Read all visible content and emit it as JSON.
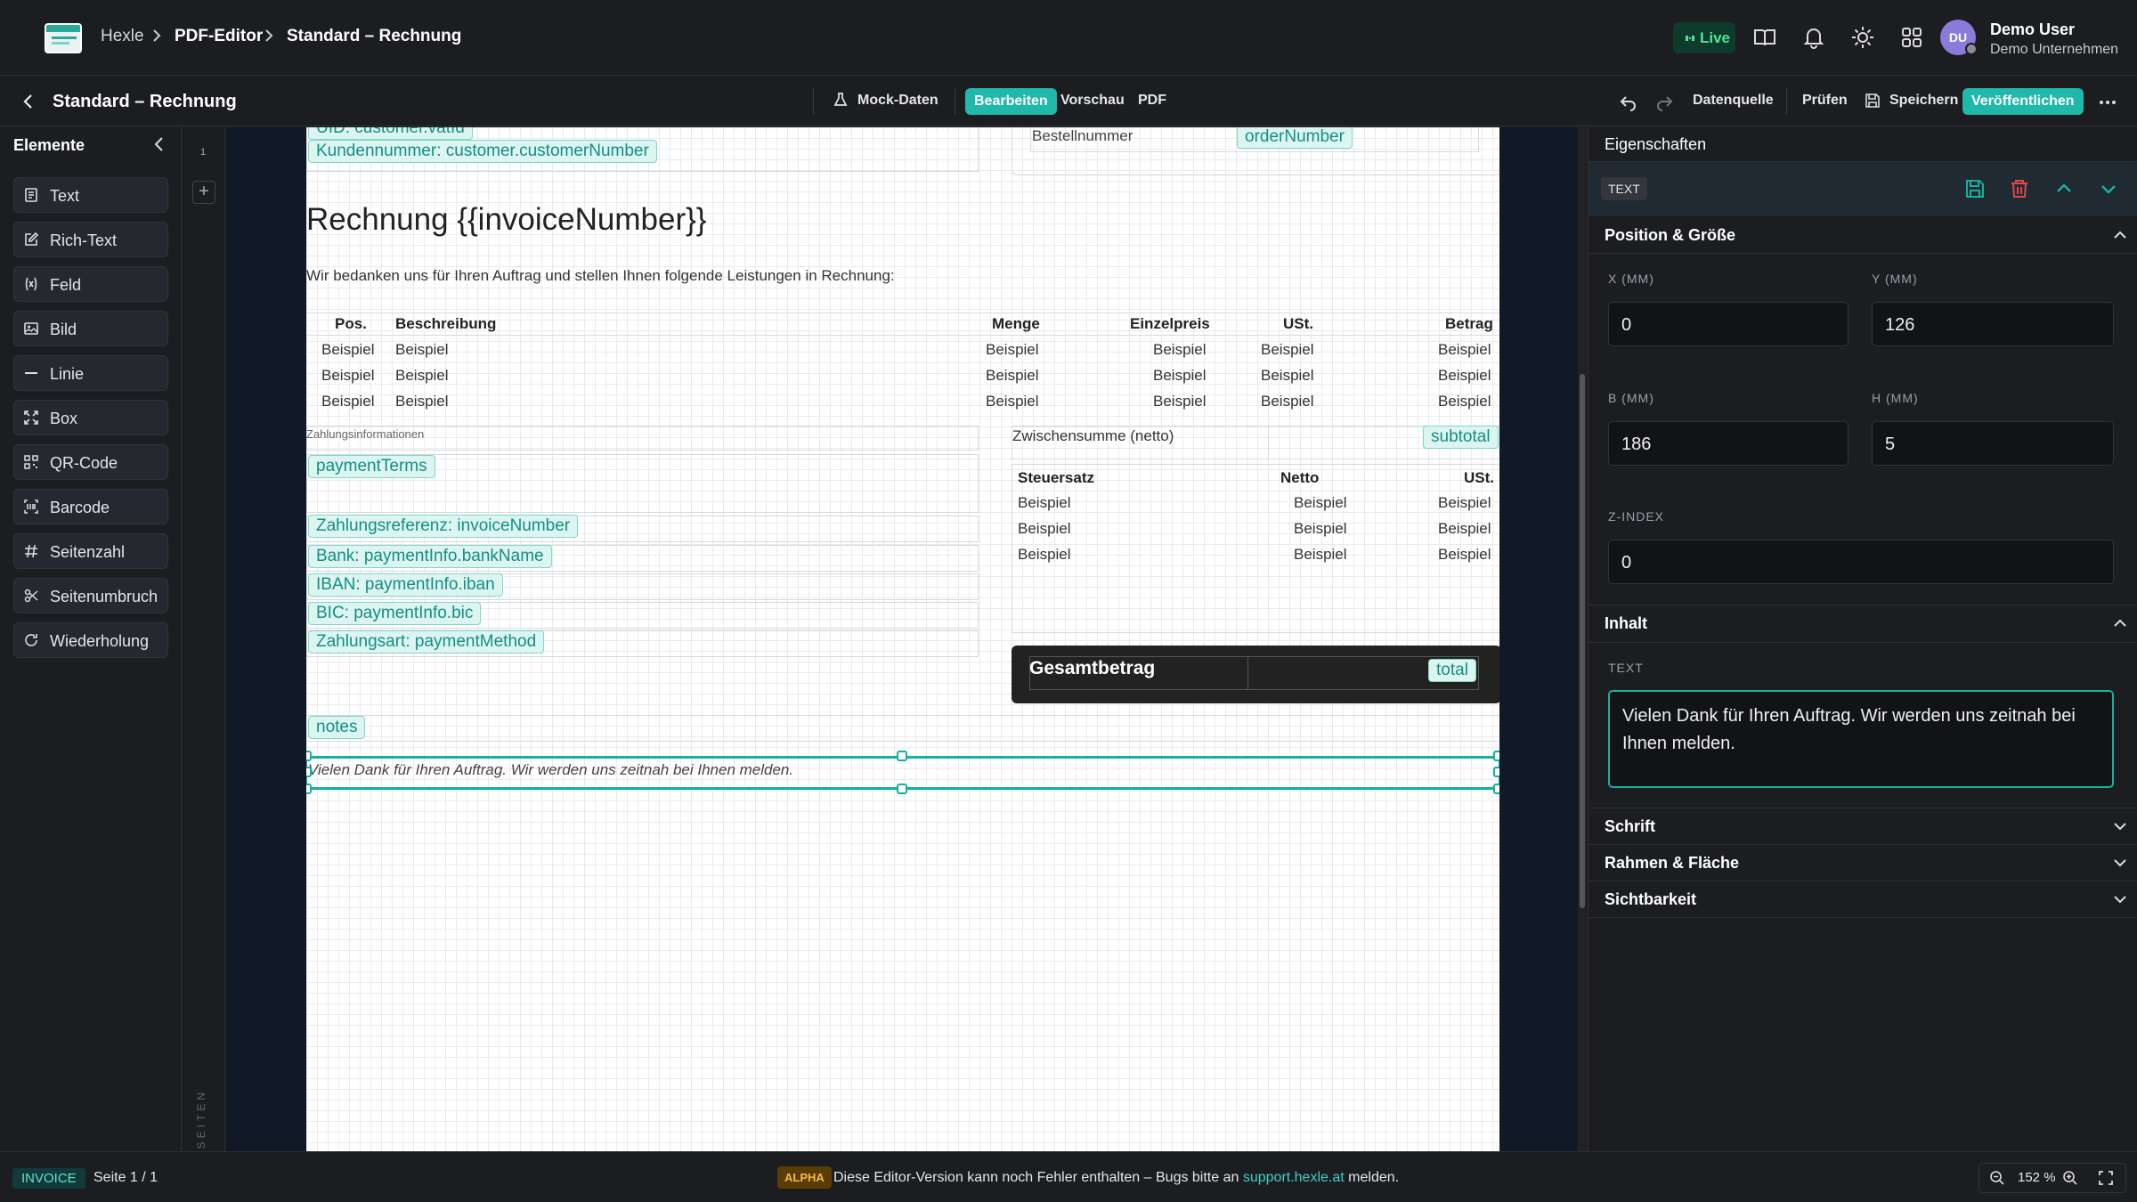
{
  "topbar": {
    "breadcrumb": [
      "Hexle",
      "PDF-Editor",
      "Standard – Rechnung"
    ],
    "live_label": "Live",
    "user": {
      "initials": "DU",
      "name": "Demo User",
      "company": "Demo Unternehmen"
    }
  },
  "toolbar": {
    "title": "Standard – Rechnung",
    "mock_data": "Mock-Daten",
    "modes": [
      "Bearbeiten",
      "Vorschau",
      "PDF"
    ],
    "active_mode": "Bearbeiten",
    "datasource": "Datenquelle",
    "check": "Prüfen",
    "save": "Speichern",
    "publish": "Veröffentlichen"
  },
  "elements_panel": {
    "title": "Elemente",
    "items": [
      "Text",
      "Rich-Text",
      "Feld",
      "Bild",
      "Linie",
      "Box",
      "QR-Code",
      "Barcode",
      "Seitenzahl",
      "Seitenumbruch",
      "Wiederholung"
    ]
  },
  "pages": {
    "current": "1",
    "label": "SEITEN"
  },
  "document": {
    "top_fields": [
      "UID: customer.vatId",
      "Kundennummer: customer.customerNumber"
    ],
    "order_label": "Bestellnummer",
    "order_field": "orderNumber",
    "title": "Rechnung {{invoiceNumber}}",
    "intro": "Wir bedanken uns für Ihren Auftrag und stellen Ihnen folgende Leistungen in Rechnung:",
    "items_table": {
      "headers": [
        "Pos.",
        "Beschreibung",
        "Menge",
        "Einzelpreis",
        "USt.",
        "Betrag"
      ],
      "rows": [
        [
          "Beispiel",
          "Beispiel",
          "Beispiel",
          "Beispiel",
          "Beispiel",
          "Beispiel"
        ],
        [
          "Beispiel",
          "Beispiel",
          "Beispiel",
          "Beispiel",
          "Beispiel",
          "Beispiel"
        ],
        [
          "Beispiel",
          "Beispiel",
          "Beispiel",
          "Beispiel",
          "Beispiel",
          "Beispiel"
        ]
      ]
    },
    "payment_heading": "Zahlungsinformationen",
    "payment_terms": "paymentTerms",
    "payment_fields": [
      "Zahlungsreferenz: invoiceNumber",
      "Bank: paymentInfo.bankName",
      "IBAN: paymentInfo.iban",
      "BIC: paymentInfo.bic",
      "Zahlungsart: paymentMethod"
    ],
    "subtotal_label": "Zwischensumme (netto)",
    "subtotal_field": "subtotal",
    "tax_table": {
      "headers": [
        "Steuersatz",
        "Netto",
        "USt."
      ],
      "rows": [
        [
          "Beispiel",
          "Beispiel",
          "Beispiel"
        ],
        [
          "Beispiel",
          "Beispiel",
          "Beispiel"
        ],
        [
          "Beispiel",
          "Beispiel",
          "Beispiel"
        ]
      ]
    },
    "total_label": "Gesamtbetrag",
    "total_field": "total",
    "notes_field": "notes",
    "footer_text": "Vielen Dank für Ihren Auftrag. Wir werden uns zeitnah bei Ihnen melden."
  },
  "properties": {
    "title": "Eigenschaften",
    "type": "TEXT",
    "position_section": "Position & Größe",
    "x_label": "X (MM)",
    "x": "0",
    "y_label": "Y (MM)",
    "y": "126",
    "w_label": "B (MM)",
    "w": "186",
    "h_label": "H (MM)",
    "h": "5",
    "z_label": "Z-INDEX",
    "z": "0",
    "content_section": "Inhalt",
    "text_label": "TEXT",
    "text_value": "Vielen Dank für Ihren Auftrag. Wir werden uns zeitnah bei Ihnen melden.",
    "font_section": "Schrift",
    "border_section": "Rahmen & Fläche",
    "visibility_section": "Sichtbarkeit"
  },
  "statusbar": {
    "doc_type": "INVOICE",
    "page": "Seite 1 / 1",
    "alpha": "ALPHA",
    "message_before": "Diese Editor-Version kann noch Fehler enthalten – Bugs bitte an",
    "link": "support.hexle.at",
    "message_after": "melden.",
    "zoom": "152 %"
  },
  "colors": {
    "accent": "#16b0a2",
    "live": "#4ee39a",
    "delete": "#e0484a",
    "alpha": "#f5b94a"
  }
}
